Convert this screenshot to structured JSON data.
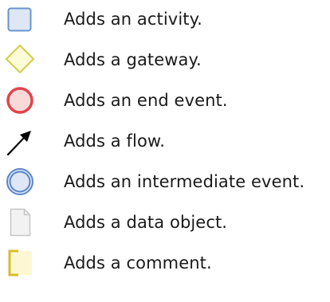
{
  "palette": {
    "items": [
      {
        "icon": "activity-icon",
        "label": "Adds an activity.",
        "colors": {
          "fill": "#dde7f5",
          "stroke": "#6a94cc"
        }
      },
      {
        "icon": "gateway-icon",
        "label": "Adds a gateway.",
        "colors": {
          "fill": "#fdfbd8",
          "stroke": "#d3cd4b"
        }
      },
      {
        "icon": "end-event-icon",
        "label": "Adds an end event.",
        "colors": {
          "fill": "#fad9d9",
          "stroke": "#e0464a"
        }
      },
      {
        "icon": "flow-arrow-icon",
        "label": "Adds a flow.",
        "colors": {
          "stroke": "#000000"
        }
      },
      {
        "icon": "intermediate-event-icon",
        "label": "Adds an intermediate event.",
        "colors": {
          "fill": "#dde7f5",
          "stroke": "#5b87c7"
        }
      },
      {
        "icon": "data-object-icon",
        "label": "Adds a data object.",
        "colors": {
          "fill": "#f2f2f2",
          "stroke": "#c6c6c6"
        }
      },
      {
        "icon": "comment-icon",
        "label": "Adds a comment.",
        "colors": {
          "fill": "#fdf8d3",
          "stroke": "#d8bc2c"
        }
      }
    ]
  }
}
